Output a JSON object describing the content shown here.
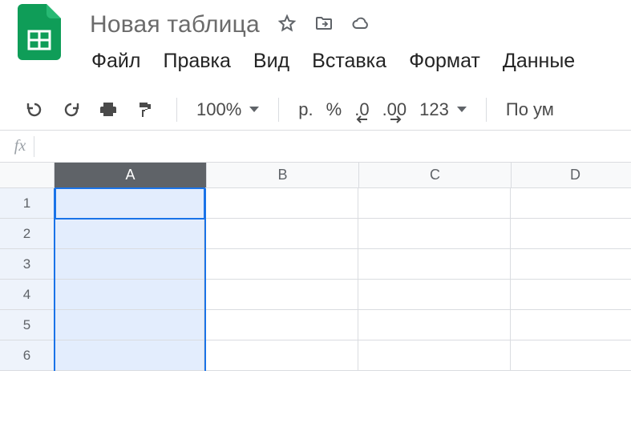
{
  "doc": {
    "title": "Новая таблица"
  },
  "menu": {
    "file": "Файл",
    "edit": "Правка",
    "view": "Вид",
    "insert": "Вставка",
    "format": "Формат",
    "data": "Данные"
  },
  "toolbar": {
    "zoom": "100%",
    "currency": "р.",
    "percent": "%",
    "dec_decrease": ".0",
    "dec_increase": ".00",
    "num_format": "123",
    "font_truncated": "По ум"
  },
  "fx": {
    "label": "fx",
    "value": ""
  },
  "columns": [
    "A",
    "B",
    "C",
    "D"
  ],
  "rows": [
    "1",
    "2",
    "3",
    "4",
    "5",
    "6"
  ],
  "selection": {
    "column": "A",
    "active_row": "1"
  }
}
